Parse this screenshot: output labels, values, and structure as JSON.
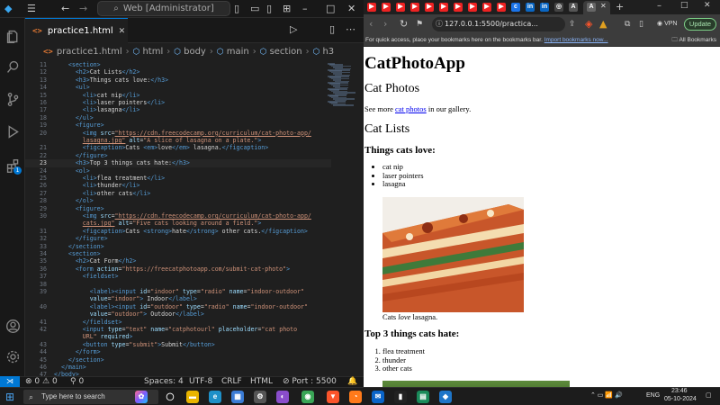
{
  "vscode": {
    "command_center": "Web [Administrator]",
    "tab_label": "practice1.html",
    "tab_icon": "html-file-icon",
    "breadcrumb": [
      "practice1.html",
      "html",
      "body",
      "main",
      "section",
      "h3"
    ],
    "notification_badge": "1",
    "active_line": "23",
    "code_lines": [
      {
        "n": "11",
        "html": "    <span class='tg'>&lt;section&gt;</span>"
      },
      {
        "n": "12",
        "html": "      <span class='tg'>&lt;h2&gt;</span>Cat Lists<span class='tg'>&lt;/h2&gt;</span>"
      },
      {
        "n": "13",
        "html": "      <span class='tg'>&lt;h3&gt;</span>Things cats love:<span class='tg'>&lt;/h3&gt;</span>"
      },
      {
        "n": "14",
        "html": "      <span class='tg'>&lt;ul&gt;</span>"
      },
      {
        "n": "15",
        "html": "        <span class='tg'>&lt;li&gt;</span>cat nip<span class='tg'>&lt;/li&gt;</span>"
      },
      {
        "n": "16",
        "html": "        <span class='tg'>&lt;li&gt;</span>laser pointers<span class='tg'>&lt;/li&gt;</span>"
      },
      {
        "n": "17",
        "html": "        <span class='tg'>&lt;li&gt;</span>lasagna<span class='tg'>&lt;/li&gt;</span>"
      },
      {
        "n": "18",
        "html": "      <span class='tg'>&lt;/ul&gt;</span>"
      },
      {
        "n": "19",
        "html": "      <span class='tg'>&lt;figure&gt;</span>"
      },
      {
        "n": "20",
        "html": "        <span class='tg'>&lt;img</span> <span class='at'>src</span>=<span class='st ul'>\"https://cdn.freecodecamp.org/curriculum/cat-photo-app/</span>"
      },
      {
        "n": "",
        "html": "        <span class='st ul'>lasagna.jpg\"</span> <span class='at'>alt</span>=<span class='st'>\"A slice of lasagna on a plate.\"</span><span class='tg'>&gt;</span>"
      },
      {
        "n": "21",
        "html": "        <span class='tg'>&lt;figcaption&gt;</span>Cats <span class='tg'>&lt;em&gt;</span>love<span class='tg'>&lt;/em&gt;</span> lasagna.<span class='tg'>&lt;/figcaption&gt;</span>"
      },
      {
        "n": "22",
        "html": "      <span class='tg'>&lt;/figure&gt;</span>"
      },
      {
        "n": "23",
        "html": "      <span class='tg'>&lt;h3&gt;</span>Top 3 things cats hate:<span class='tg'>&lt;/h3&gt;</span>"
      },
      {
        "n": "24",
        "html": "      <span class='tg'>&lt;ol&gt;</span>"
      },
      {
        "n": "25",
        "html": "        <span class='tg'>&lt;li&gt;</span>flea treatment<span class='tg'>&lt;/li&gt;</span>"
      },
      {
        "n": "26",
        "html": "        <span class='tg'>&lt;li&gt;</span>thunder<span class='tg'>&lt;/li&gt;</span>"
      },
      {
        "n": "27",
        "html": "        <span class='tg'>&lt;li&gt;</span>other cats<span class='tg'>&lt;/li&gt;</span>"
      },
      {
        "n": "28",
        "html": "      <span class='tg'>&lt;/ol&gt;</span>"
      },
      {
        "n": "29",
        "html": "      <span class='tg'>&lt;figure&gt;</span>"
      },
      {
        "n": "30",
        "html": "        <span class='tg'>&lt;img</span> <span class='at'>src</span>=<span class='st ul'>\"https://cdn.freecodecamp.org/curriculum/cat-photo-app/</span>"
      },
      {
        "n": "",
        "html": "        <span class='st ul'>cats.jpg\"</span> <span class='at'>alt</span>=<span class='st'>\"Five cats looking around a field.\"</span><span class='tg'>&gt;</span>"
      },
      {
        "n": "31",
        "html": "        <span class='tg'>&lt;figcaption&gt;</span>Cats <span class='tg'>&lt;strong&gt;</span>hate<span class='tg'>&lt;/strong&gt;</span> other cats.<span class='tg'>&lt;/figcaption&gt;</span>"
      },
      {
        "n": "32",
        "html": "      <span class='tg'>&lt;/figure&gt;</span>"
      },
      {
        "n": "33",
        "html": "    <span class='tg'>&lt;/section&gt;</span>"
      },
      {
        "n": "34",
        "html": "    <span class='tg'>&lt;section&gt;</span>"
      },
      {
        "n": "35",
        "html": "      <span class='tg'>&lt;h2&gt;</span>Cat Form<span class='tg'>&lt;/h2&gt;</span>"
      },
      {
        "n": "36",
        "html": "      <span class='tg'>&lt;form</span> <span class='at'>action</span>=<span class='st'>\"https://freecatphotoapp.com/submit-cat-photo\"</span><span class='tg'>&gt;</span>"
      },
      {
        "n": "37",
        "html": "        <span class='tg'>&lt;fieldset&gt;</span>"
      },
      {
        "n": "38",
        "html": ""
      },
      {
        "n": "39",
        "html": "          <span class='tg'>&lt;label&gt;&lt;input</span> <span class='at'>id</span>=<span class='st'>\"indoor\"</span> <span class='at'>type</span>=<span class='st'>\"radio\"</span> <span class='at'>name</span>=<span class='st'>\"indoor-outdoor\"</span>"
      },
      {
        "n": "",
        "html": "          <span class='at'>value</span>=<span class='st'>\"indoor\"</span><span class='tg'>&gt;</span> Indoor<span class='tg'>&lt;/label&gt;</span>"
      },
      {
        "n": "40",
        "html": "          <span class='tg'>&lt;label&gt;&lt;input</span> <span class='at'>id</span>=<span class='st'>\"outdoor\"</span> <span class='at'>type</span>=<span class='st'>\"radio\"</span> <span class='at'>name</span>=<span class='st'>\"indoor-outdoor\"</span>"
      },
      {
        "n": "",
        "html": "          <span class='at'>value</span>=<span class='st'>\"outdoor\"</span><span class='tg'>&gt;</span> Outdoor<span class='tg'>&lt;/label&gt;</span>"
      },
      {
        "n": "41",
        "html": "        <span class='tg'>&lt;/fieldset&gt;</span>"
      },
      {
        "n": "42",
        "html": "        <span class='tg'>&lt;input</span> <span class='at'>type</span>=<span class='st'>\"text\"</span> <span class='at'>name</span>=<span class='st'>\"catphotourl\"</span> <span class='at'>placeholder</span>=<span class='st'>\"cat photo</span>"
      },
      {
        "n": "",
        "html": "        <span class='st'>URL\"</span> <span class='at'>required</span><span class='tg'>&gt;</span>"
      },
      {
        "n": "43",
        "html": "        <span class='tg'>&lt;button</span> <span class='at'>type</span>=<span class='st'>\"submit\"</span><span class='tg'>&gt;</span>Submit<span class='tg'>&lt;/button&gt;</span>"
      },
      {
        "n": "44",
        "html": "      <span class='tg'>&lt;/form&gt;</span>"
      },
      {
        "n": "45",
        "html": "    <span class='tg'>&lt;/section&gt;</span>"
      },
      {
        "n": "46",
        "html": "  <span class='tg'>&lt;/main&gt;</span>"
      },
      {
        "n": "47",
        "html": "<span class='tg'>&lt;/body&gt;</span>"
      }
    ],
    "status": {
      "errors": "0",
      "warnings": "0",
      "ports": "0",
      "spaces": "Spaces: 4",
      "encoding": "UTF-8",
      "eol": "CRLF",
      "language": "HTML",
      "port": "Port : 5500"
    }
  },
  "browser": {
    "address": "127.0.0.1:5500/practica...",
    "update_label": "Update",
    "vpn_label": "VPN",
    "bookmarks_text": "For quick access, place your bookmarks here on the bookmarks bar.",
    "bookmarks_link": "Import bookmarks now...",
    "all_bookmarks": "All Bookmarks",
    "page": {
      "title": "CatPhotoApp",
      "section1_heading": "Cat Photos",
      "see_more_pre": "See more ",
      "see_more_link": "cat photos",
      "see_more_post": " in our gallery.",
      "section2_heading": "Cat Lists",
      "love_heading": "Things cats love:",
      "love_items": [
        "cat nip",
        "laser pointers",
        "lasagna"
      ],
      "caption1_pre": "Cats ",
      "caption1_em": "love",
      "caption1_post": " lasagna.",
      "hate_heading": "Top 3 things cats hate:",
      "hate_items": [
        "flea treatment",
        "thunder",
        "other cats"
      ]
    }
  },
  "taskbar": {
    "search_placeholder": "Type here to search",
    "language": "ENG",
    "time": "23:46",
    "date": "05-10-2024"
  }
}
